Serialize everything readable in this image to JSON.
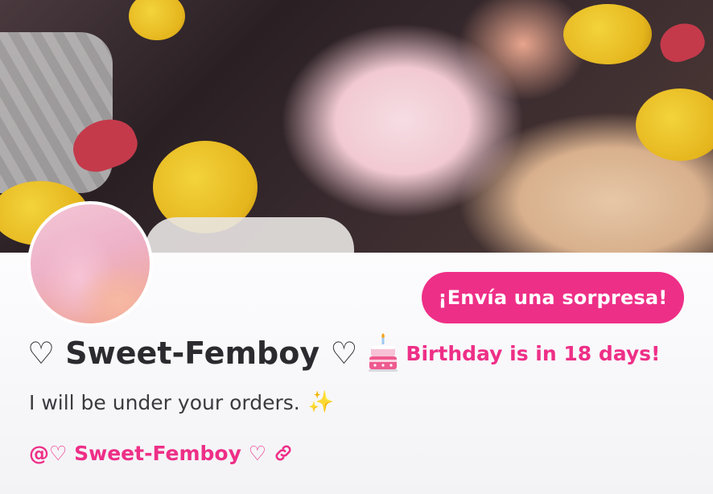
{
  "banner": {
    "alt": "Cover photo"
  },
  "profile": {
    "display_name": "♡ Sweet-Femboy ♡",
    "birthday_text": "Birthday is in 18 days!",
    "bio": "I will be under your orders.",
    "bio_emoji": "✨",
    "handle": "@♡ Sweet-Femboy ♡",
    "handle_icon": "link-icon",
    "birthday_icon": "birthday-cake-icon"
  },
  "actions": {
    "surprise_label": "¡Envía una sorpresa!"
  },
  "colors": {
    "accent": "#ee2f87",
    "name_text": "#2b2b2f",
    "bio_text": "#3a3a3f",
    "background": "#ffffff"
  }
}
